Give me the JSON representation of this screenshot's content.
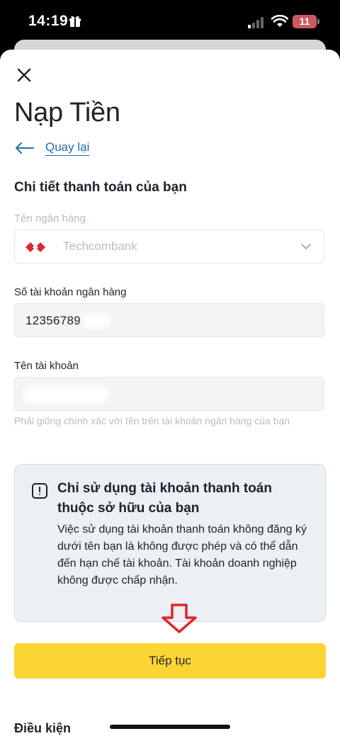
{
  "status_bar": {
    "time": "14:19",
    "battery": "11",
    "icons": [
      "gift-icon",
      "signal-icon",
      "wifi-icon",
      "battery-icon"
    ]
  },
  "header": {
    "title": "Nạp Tiền",
    "back_label": "Quay lại"
  },
  "form": {
    "section_title": "Chi tiết thanh toán của bạn",
    "bank": {
      "label": "Tên ngân hàng",
      "value": "Techcombank"
    },
    "account_number": {
      "label": "Số tài khoản ngân hàng",
      "value": "12356789"
    },
    "account_name": {
      "label": "Tên tài khoản",
      "value": "",
      "helper": "Phải giống chính xác với tên trên tài khoản ngân hàng của bạn"
    }
  },
  "notice": {
    "title": "Chỉ sử dụng tài khoản thanh toán thuộc sở hữu của bạn",
    "body": "Việc sử dụng tài khoản thanh toán không đăng ký dưới tên bạn là không được phép và có thể dẫn đến hạn chế tài khoản. Tài khoản doanh nghiệp không được chấp nhận."
  },
  "actions": {
    "continue_label": "Tiếp tục"
  },
  "footer": {
    "terms_heading": "Điều kiện"
  },
  "colors": {
    "accent_yellow": "#fcd535",
    "link_blue": "#1e6fa8",
    "techcombank_red": "#e0262b",
    "annotation_red": "#e0262b"
  }
}
